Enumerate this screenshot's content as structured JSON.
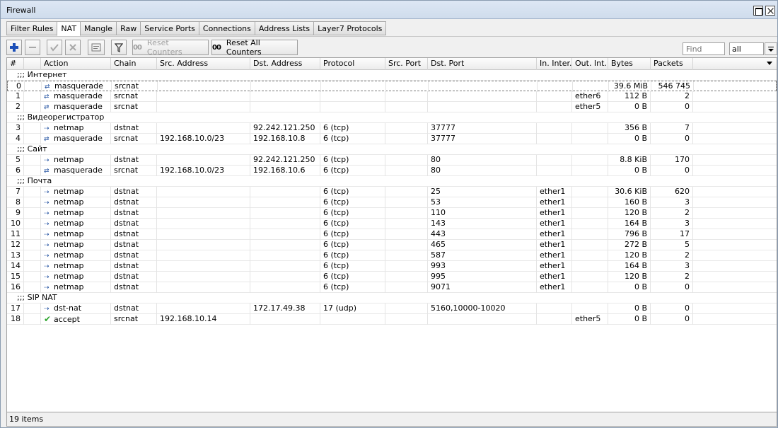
{
  "window": {
    "title": "Firewall"
  },
  "tabs": [
    "Filter Rules",
    "NAT",
    "Mangle",
    "Raw",
    "Service Ports",
    "Connections",
    "Address Lists",
    "Layer7 Protocols"
  ],
  "toolbar": {
    "reset_counters": "Reset Counters",
    "reset_all_counters": "Reset All Counters",
    "find_placeholder": "Find",
    "filter_value": "all",
    "counter_icon": "00"
  },
  "columns": [
    "#",
    "Action",
    "Chain",
    "Src. Address",
    "Dst. Address",
    "Protocol",
    "Src. Port",
    "Dst. Port",
    "In. Inter...",
    "Out. Int...",
    "Bytes",
    "Packets"
  ],
  "rows": [
    {
      "type": "comment",
      "text": ";;; Интернет"
    },
    {
      "type": "rule",
      "num": "0",
      "icon": "masquerade",
      "action": "masquerade",
      "chain": "srcnat",
      "src": "",
      "dst": "",
      "proto": "",
      "sport": "",
      "dport": "",
      "in": "",
      "out": "",
      "bytes": "39.6 MiB",
      "packets": "546 745",
      "selected": true
    },
    {
      "type": "rule",
      "num": "1",
      "icon": "masquerade",
      "action": "masquerade",
      "chain": "srcnat",
      "src": "",
      "dst": "",
      "proto": "",
      "sport": "",
      "dport": "",
      "in": "",
      "out": "ether6",
      "bytes": "112 B",
      "packets": "2"
    },
    {
      "type": "rule",
      "num": "2",
      "icon": "masquerade",
      "action": "masquerade",
      "chain": "srcnat",
      "src": "",
      "dst": "",
      "proto": "",
      "sport": "",
      "dport": "",
      "in": "",
      "out": "ether5",
      "bytes": "0 B",
      "packets": "0"
    },
    {
      "type": "comment",
      "text": ";;; Видеорегистратор"
    },
    {
      "type": "rule",
      "num": "3",
      "icon": "netmap",
      "action": "netmap",
      "chain": "dstnat",
      "src": "",
      "dst": "92.242.121.250",
      "proto": "6 (tcp)",
      "sport": "",
      "dport": "37777",
      "in": "",
      "out": "",
      "bytes": "356 B",
      "packets": "7"
    },
    {
      "type": "rule",
      "num": "4",
      "icon": "masquerade",
      "action": "masquerade",
      "chain": "srcnat",
      "src": "192.168.10.0/23",
      "dst": "192.168.10.8",
      "proto": "6 (tcp)",
      "sport": "",
      "dport": "37777",
      "in": "",
      "out": "",
      "bytes": "0 B",
      "packets": "0"
    },
    {
      "type": "comment",
      "text": ";;; Сайт"
    },
    {
      "type": "rule",
      "num": "5",
      "icon": "netmap",
      "action": "netmap",
      "chain": "dstnat",
      "src": "",
      "dst": "92.242.121.250",
      "proto": "6 (tcp)",
      "sport": "",
      "dport": "80",
      "in": "",
      "out": "",
      "bytes": "8.8 KiB",
      "packets": "170"
    },
    {
      "type": "rule",
      "num": "6",
      "icon": "masquerade",
      "action": "masquerade",
      "chain": "srcnat",
      "src": "192.168.10.0/23",
      "dst": "192.168.10.6",
      "proto": "6 (tcp)",
      "sport": "",
      "dport": "80",
      "in": "",
      "out": "",
      "bytes": "0 B",
      "packets": "0"
    },
    {
      "type": "comment",
      "text": ";;; Почта"
    },
    {
      "type": "rule",
      "num": "7",
      "icon": "netmap",
      "action": "netmap",
      "chain": "dstnat",
      "src": "",
      "dst": "",
      "proto": "6 (tcp)",
      "sport": "",
      "dport": "25",
      "in": "ether1",
      "out": "",
      "bytes": "30.6 KiB",
      "packets": "620"
    },
    {
      "type": "rule",
      "num": "8",
      "icon": "netmap",
      "action": "netmap",
      "chain": "dstnat",
      "src": "",
      "dst": "",
      "proto": "6 (tcp)",
      "sport": "",
      "dport": "53",
      "in": "ether1",
      "out": "",
      "bytes": "160 B",
      "packets": "3"
    },
    {
      "type": "rule",
      "num": "9",
      "icon": "netmap",
      "action": "netmap",
      "chain": "dstnat",
      "src": "",
      "dst": "",
      "proto": "6 (tcp)",
      "sport": "",
      "dport": "110",
      "in": "ether1",
      "out": "",
      "bytes": "120 B",
      "packets": "2"
    },
    {
      "type": "rule",
      "num": "10",
      "icon": "netmap",
      "action": "netmap",
      "chain": "dstnat",
      "src": "",
      "dst": "",
      "proto": "6 (tcp)",
      "sport": "",
      "dport": "143",
      "in": "ether1",
      "out": "",
      "bytes": "164 B",
      "packets": "3"
    },
    {
      "type": "rule",
      "num": "11",
      "icon": "netmap",
      "action": "netmap",
      "chain": "dstnat",
      "src": "",
      "dst": "",
      "proto": "6 (tcp)",
      "sport": "",
      "dport": "443",
      "in": "ether1",
      "out": "",
      "bytes": "796 B",
      "packets": "17"
    },
    {
      "type": "rule",
      "num": "12",
      "icon": "netmap",
      "action": "netmap",
      "chain": "dstnat",
      "src": "",
      "dst": "",
      "proto": "6 (tcp)",
      "sport": "",
      "dport": "465",
      "in": "ether1",
      "out": "",
      "bytes": "272 B",
      "packets": "5"
    },
    {
      "type": "rule",
      "num": "13",
      "icon": "netmap",
      "action": "netmap",
      "chain": "dstnat",
      "src": "",
      "dst": "",
      "proto": "6 (tcp)",
      "sport": "",
      "dport": "587",
      "in": "ether1",
      "out": "",
      "bytes": "120 B",
      "packets": "2"
    },
    {
      "type": "rule",
      "num": "14",
      "icon": "netmap",
      "action": "netmap",
      "chain": "dstnat",
      "src": "",
      "dst": "",
      "proto": "6 (tcp)",
      "sport": "",
      "dport": "993",
      "in": "ether1",
      "out": "",
      "bytes": "164 B",
      "packets": "3"
    },
    {
      "type": "rule",
      "num": "15",
      "icon": "netmap",
      "action": "netmap",
      "chain": "dstnat",
      "src": "",
      "dst": "",
      "proto": "6 (tcp)",
      "sport": "",
      "dport": "995",
      "in": "ether1",
      "out": "",
      "bytes": "120 B",
      "packets": "2"
    },
    {
      "type": "rule",
      "num": "16",
      "icon": "netmap",
      "action": "netmap",
      "chain": "dstnat",
      "src": "",
      "dst": "",
      "proto": "6 (tcp)",
      "sport": "",
      "dport": "9071",
      "in": "ether1",
      "out": "",
      "bytes": "0 B",
      "packets": "0"
    },
    {
      "type": "comment",
      "text": ";;; SIP NAT"
    },
    {
      "type": "rule",
      "num": "17",
      "icon": "netmap",
      "action": "dst-nat",
      "chain": "dstnat",
      "src": "",
      "dst": "172.17.49.38",
      "proto": "17 (udp)",
      "sport": "",
      "dport": "5160,10000-10020",
      "in": "",
      "out": "",
      "bytes": "0 B",
      "packets": "0"
    },
    {
      "type": "rule",
      "num": "18",
      "icon": "accept",
      "action": "accept",
      "chain": "srcnat",
      "src": "192.168.10.14",
      "dst": "",
      "proto": "",
      "sport": "",
      "dport": "",
      "in": "",
      "out": "ether5",
      "bytes": "0 B",
      "packets": "0"
    }
  ],
  "status": {
    "items_count": "19 items"
  }
}
